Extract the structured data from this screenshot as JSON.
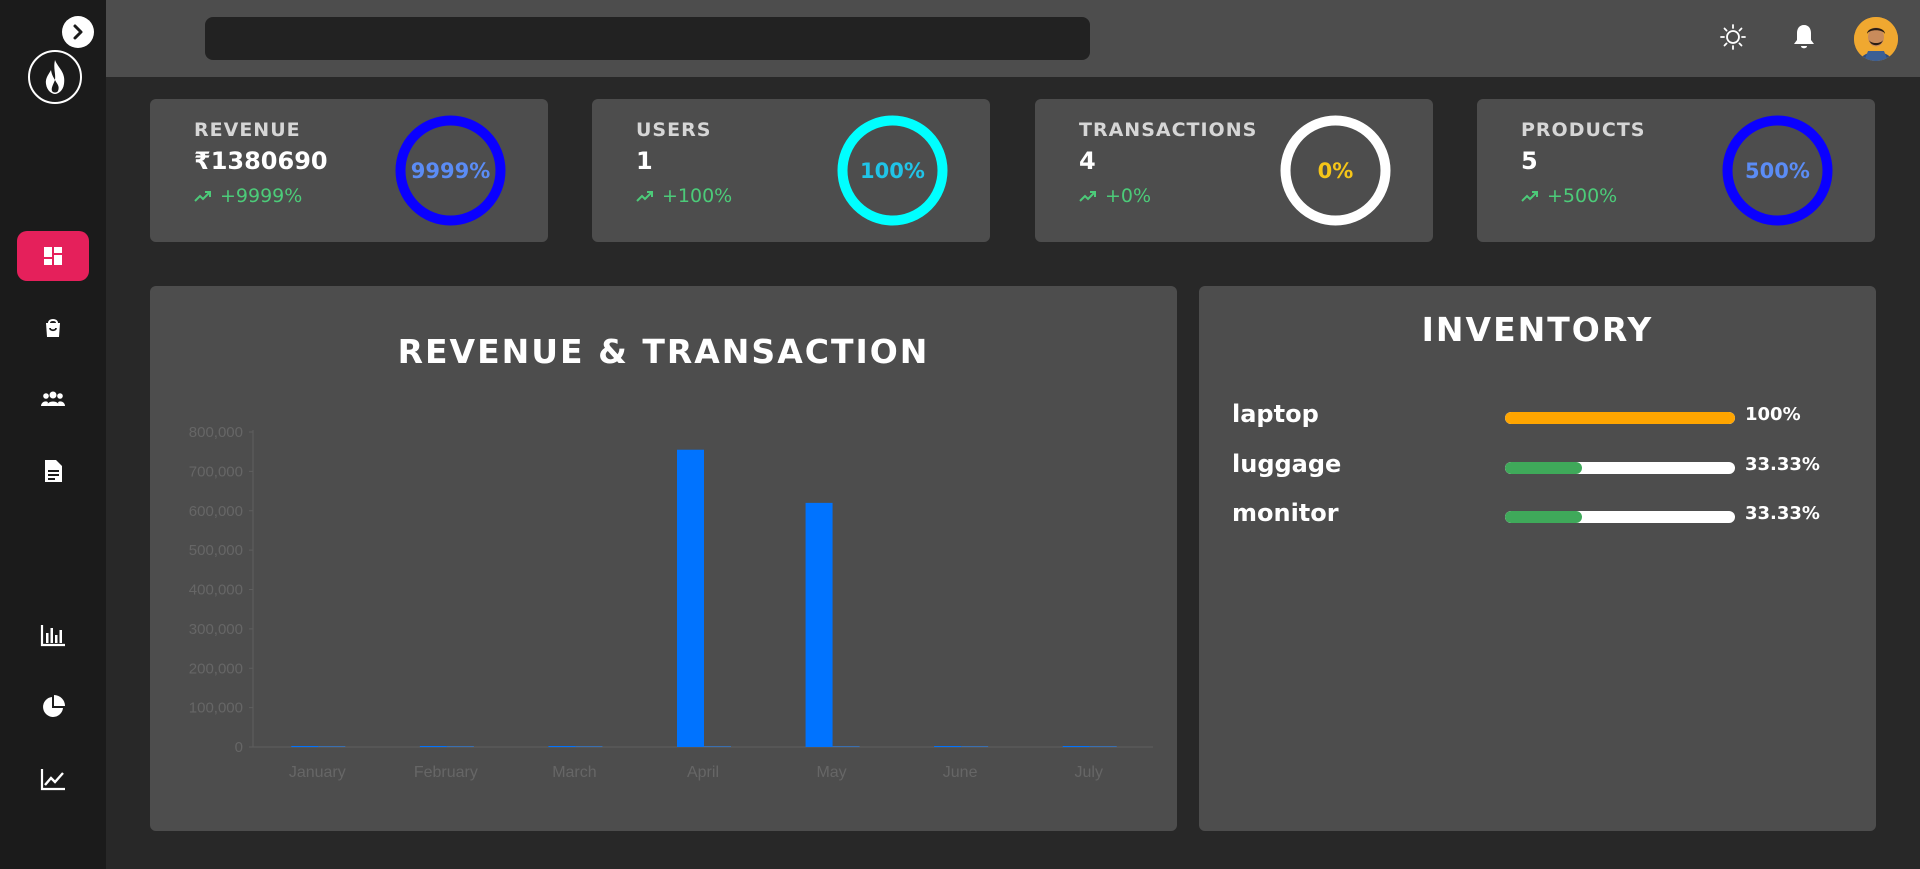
{
  "sidebar": {
    "toggle_icon": "chevron-right-icon",
    "logo_icon": "flame-icon",
    "items": [
      {
        "name": "dashboard",
        "icon": "dashboard-icon",
        "active": true
      },
      {
        "name": "products",
        "icon": "shopping-bag-icon",
        "active": false
      },
      {
        "name": "customers",
        "icon": "group-icon",
        "active": false
      },
      {
        "name": "transactions",
        "icon": "document-icon",
        "active": false
      },
      {
        "name": "bar-chart",
        "icon": "bar-chart-icon",
        "active": false
      },
      {
        "name": "pie-chart",
        "icon": "pie-chart-icon",
        "active": false
      },
      {
        "name": "line-chart",
        "icon": "line-chart-icon",
        "active": false
      }
    ],
    "active_color": "#e5205b"
  },
  "header": {
    "search_placeholder": "",
    "icons": [
      "theme-sun-icon",
      "notification-bell-icon"
    ],
    "avatar": "user-avatar"
  },
  "stats": [
    {
      "label": "REVENUE",
      "value": "₹1380690",
      "change": "+9999%",
      "percent_text": "9999%",
      "ring_color": "#0a00ff",
      "text_color": "#5b8cf5"
    },
    {
      "label": "USERS",
      "value": "1",
      "change": "+100%",
      "percent_text": "100%",
      "ring_color": "#00ffff",
      "text_color": "#20c4e8"
    },
    {
      "label": "TRANSACTIONS",
      "value": "4",
      "change": "+0%",
      "percent_text": "0%",
      "ring_color": "#ffffff",
      "text_color": "#f5c518"
    },
    {
      "label": "PRODUCTS",
      "value": "5",
      "change": "+500%",
      "percent_text": "500%",
      "ring_color": "#0a00ff",
      "text_color": "#5b8cf5"
    }
  ],
  "chart": {
    "title": "REVENUE & TRANSACTION"
  },
  "chart_data": {
    "type": "bar",
    "categories": [
      "January",
      "February",
      "March",
      "April",
      "May",
      "June",
      "July"
    ],
    "series": [
      {
        "values": [
          0,
          0,
          0,
          755000,
          620000,
          0,
          0
        ],
        "color": "#0073ff"
      },
      {
        "values": [
          0,
          0,
          0,
          4,
          1,
          0,
          0
        ],
        "color": "#3a6fb0"
      }
    ],
    "ylim": [
      0,
      800000
    ],
    "yticks": [
      "0",
      "100,000",
      "200,000",
      "300,000",
      "400,000",
      "500,000",
      "600,000",
      "700,000",
      "800,000"
    ],
    "grid": false,
    "legend": "none"
  },
  "inventory": {
    "title": "INVENTORY",
    "items": [
      {
        "name": "laptop",
        "percent": 100,
        "percent_text": "100%",
        "color": "#ffa500"
      },
      {
        "name": "luggage",
        "percent": 33.33,
        "percent_text": "33.33%",
        "color": "#3fa95a"
      },
      {
        "name": "monitor",
        "percent": 33.33,
        "percent_text": "33.33%",
        "color": "#3fa95a"
      }
    ]
  }
}
